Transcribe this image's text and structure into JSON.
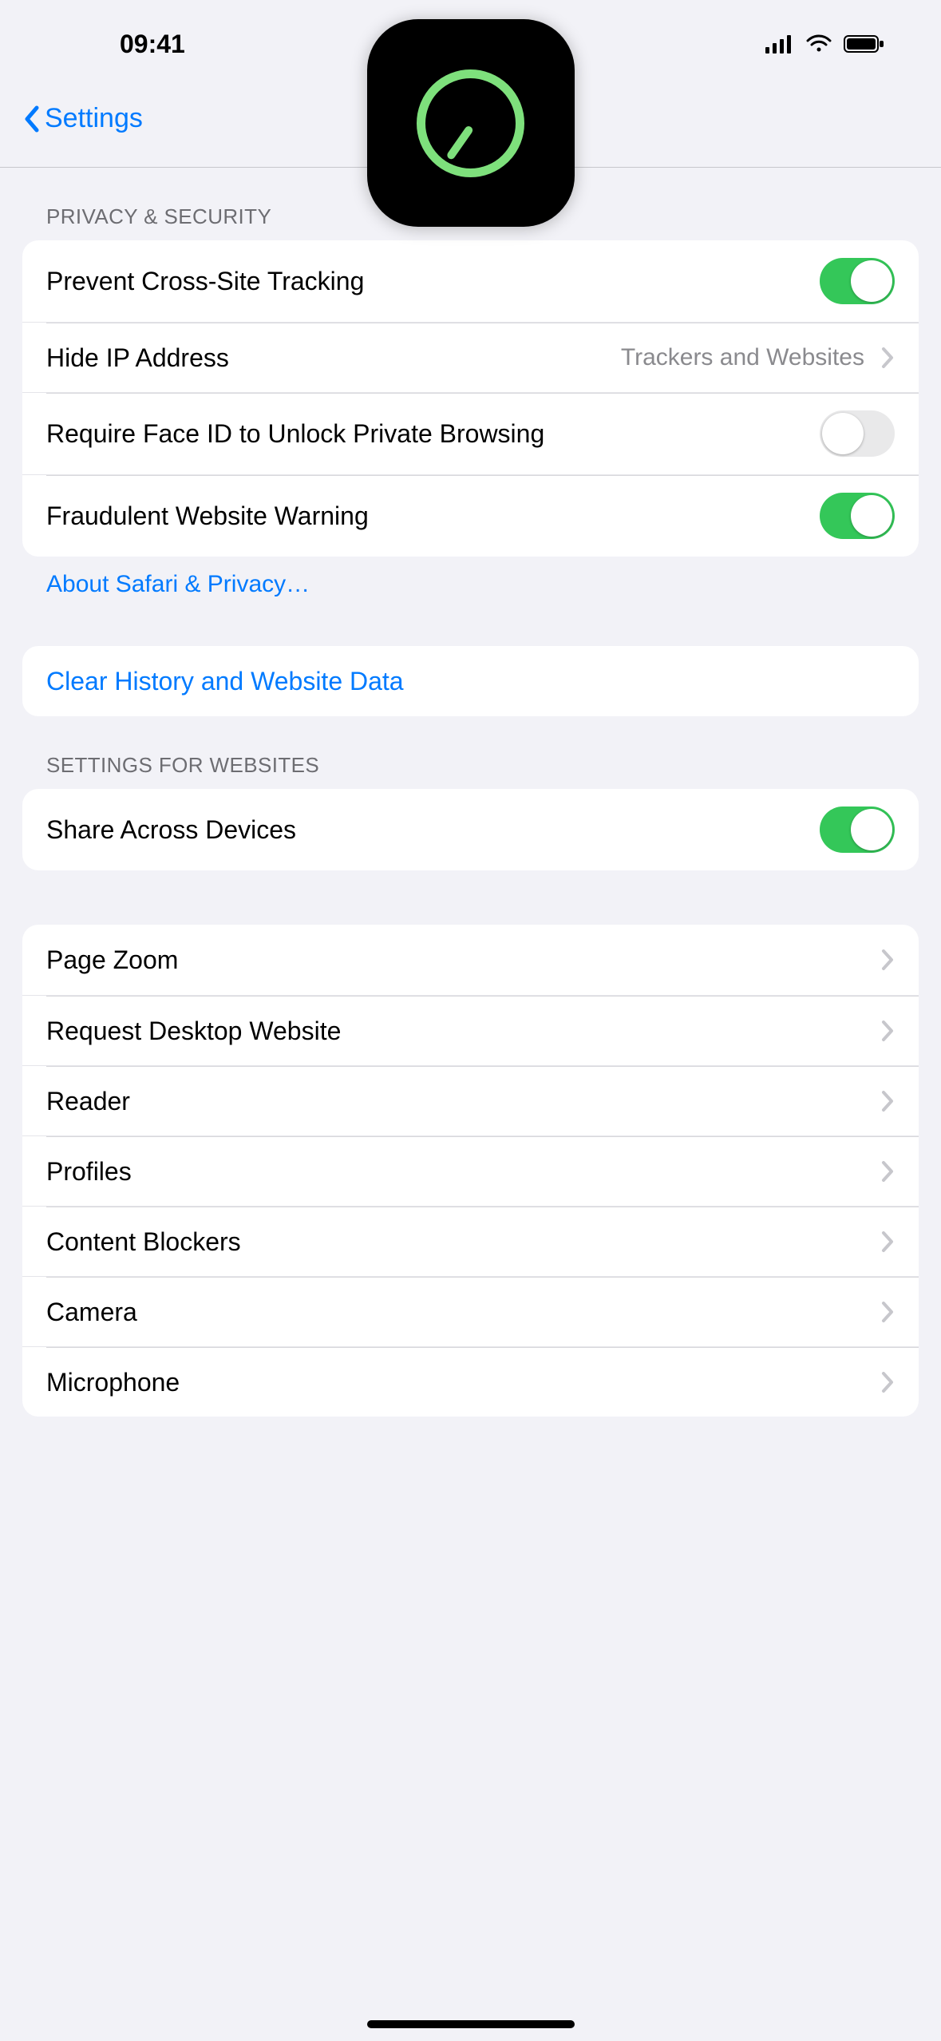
{
  "status": {
    "time": "09:41"
  },
  "nav": {
    "back_label": "Settings"
  },
  "section_privacy": {
    "header": "Privacy & Security",
    "rows": {
      "prevent_tracking": {
        "label": "Prevent Cross-Site Tracking",
        "on": true
      },
      "hide_ip": {
        "label": "Hide IP Address",
        "detail": "Trackers and Websites"
      },
      "require_faceid": {
        "label": "Require Face ID to Unlock Private Browsing",
        "on": false
      },
      "fraud_warning": {
        "label": "Fraudulent Website Warning",
        "on": true
      }
    },
    "footer": "About Safari & Privacy…"
  },
  "section_clear": {
    "rows": {
      "clear": {
        "label": "Clear History and Website Data"
      }
    }
  },
  "section_websites": {
    "header": "Settings for Websites",
    "rows": {
      "share_devices": {
        "label": "Share Across Devices",
        "on": true
      }
    }
  },
  "section_site_settings": {
    "rows": {
      "page_zoom": {
        "label": "Page Zoom"
      },
      "request_desktop": {
        "label": "Request Desktop Website"
      },
      "reader": {
        "label": "Reader"
      },
      "profiles": {
        "label": "Profiles"
      },
      "content_blockers": {
        "label": "Content Blockers"
      },
      "camera": {
        "label": "Camera"
      },
      "microphone": {
        "label": "Microphone"
      }
    }
  }
}
